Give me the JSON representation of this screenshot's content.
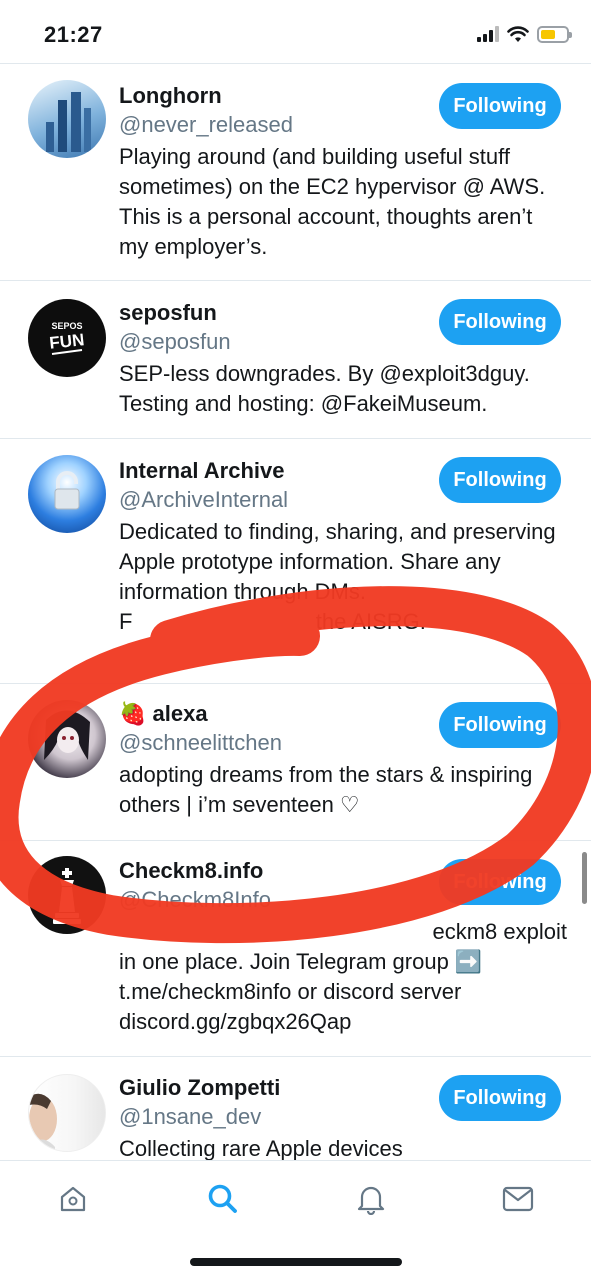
{
  "status_bar": {
    "time": "21:27"
  },
  "accounts": [
    {
      "name": "Longhorn",
      "handle": "@never_released",
      "bio": "Playing around (and building useful stuff sometimes) on the EC2 hypervisor @ AWS. This is a personal account, thoughts aren’t my employer’s.",
      "button": "Following"
    },
    {
      "name": "seposfun",
      "handle": "@seposfun",
      "bio": "SEP-less downgrades. By @exploit3dguy. Testing and hosting: @FakeiMuseum.",
      "button": "Following",
      "avatar_text_top": "SEPOS",
      "avatar_text_bottom": "FUN"
    },
    {
      "name": "Internal Archive",
      "handle": "@ArchiveInternal",
      "bio": "Dedicated to finding, sharing, and preserving Apple prototype information. Share any information through DMs.",
      "bio_partial": "F                              the AISRG.",
      "button": "Following"
    },
    {
      "name_emoji": "🍓",
      "name": "alexa",
      "handle": "@schneelittchen",
      "bio": "adopting dreams from the stars & inspiring others | i’m seventeen ♡",
      "button": "Following"
    },
    {
      "name": "Checkm8.info",
      "handle": "@Checkm8Info",
      "bio_line1": "eckm8 exploit",
      "bio_line2": "in one place. Join Telegram group ➡️",
      "bio_line3": "t.me/checkm8info or discord server",
      "bio_line4": "discord.gg/zgbqx26Qap",
      "button": "Following"
    },
    {
      "name": "Giulio Zompetti",
      "handle": "@1nsane_dev",
      "bio": "Collecting rare Apple devices",
      "button": "Following"
    }
  ],
  "tabs": {
    "home": "home-icon",
    "search": "search-icon",
    "notifications": "bell-icon",
    "messages": "mail-icon"
  },
  "colors": {
    "accent": "#1da1f2",
    "annotation": "#f03a22"
  }
}
